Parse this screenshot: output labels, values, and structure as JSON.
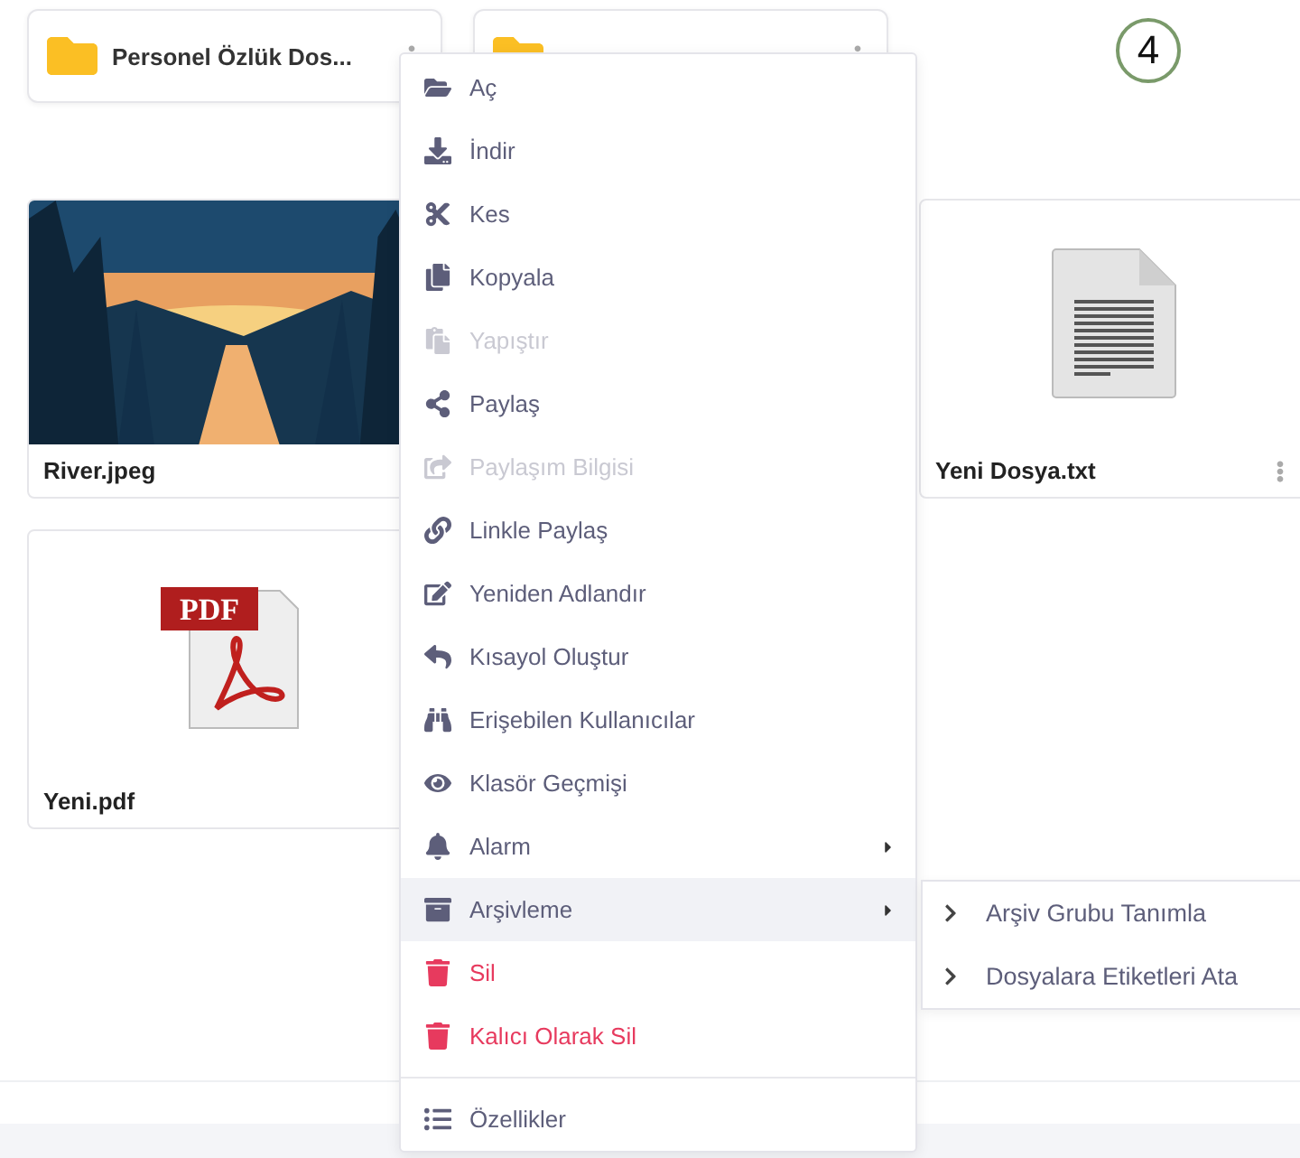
{
  "folders": [
    {
      "kind": "named",
      "name": "Personel Özlük Dos..."
    },
    {
      "kind": "covered"
    }
  ],
  "step_badge": "4",
  "files": [
    {
      "name": "River.jpeg",
      "kind": "picture"
    },
    {
      "name": "Yeni Dosya.txt",
      "kind": "text"
    },
    {
      "name": "Yeni.pdf",
      "kind": "pdf",
      "icon_label": "PDF"
    }
  ],
  "context_menu": {
    "items": [
      {
        "label": "Aç",
        "kind": "normal",
        "disabled": false,
        "selected": false,
        "submenu": false
      },
      {
        "label": "İndir",
        "kind": "normal",
        "disabled": false,
        "selected": false,
        "submenu": false
      },
      {
        "label": "Kes",
        "kind": "normal",
        "disabled": false,
        "selected": false,
        "submenu": false
      },
      {
        "label": "Kopyala",
        "kind": "normal",
        "disabled": false,
        "selected": false,
        "submenu": false
      },
      {
        "label": "Yapıştır",
        "kind": "normal",
        "disabled": true,
        "selected": false,
        "submenu": false
      },
      {
        "label": "Paylaş",
        "kind": "normal",
        "disabled": false,
        "selected": false,
        "submenu": false
      },
      {
        "label": "Paylaşım Bilgisi",
        "kind": "normal",
        "disabled": true,
        "selected": false,
        "submenu": false
      },
      {
        "label": "Linkle Paylaş",
        "kind": "normal",
        "disabled": false,
        "selected": false,
        "submenu": false
      },
      {
        "label": "Yeniden Adlandır",
        "kind": "normal",
        "disabled": false,
        "selected": false,
        "submenu": false
      },
      {
        "label": "Kısayol Oluştur",
        "kind": "normal",
        "disabled": false,
        "selected": false,
        "submenu": false
      },
      {
        "label": "Erişebilen Kullanıcılar",
        "kind": "normal",
        "disabled": false,
        "selected": false,
        "submenu": false
      },
      {
        "label": "Klasör Geçmişi",
        "kind": "normal",
        "disabled": false,
        "selected": false,
        "submenu": false
      },
      {
        "label": "Alarm",
        "kind": "normal",
        "disabled": false,
        "selected": false,
        "submenu": true
      },
      {
        "label": "Arşivleme",
        "kind": "normal",
        "disabled": false,
        "selected": true,
        "submenu": true
      },
      {
        "label": "Sil",
        "kind": "danger",
        "disabled": false,
        "selected": false,
        "submenu": false
      },
      {
        "label": "Kalıcı Olarak Sil",
        "kind": "danger",
        "disabled": false,
        "selected": false,
        "submenu": false
      },
      {
        "label": "Özellikler",
        "kind": "normal",
        "disabled": false,
        "selected": false,
        "submenu": false
      }
    ]
  },
  "submenu": {
    "items": [
      {
        "label": "Arşiv Grubu Tanımla"
      },
      {
        "label": "Dosyalara Etiketleri Ata"
      }
    ]
  }
}
